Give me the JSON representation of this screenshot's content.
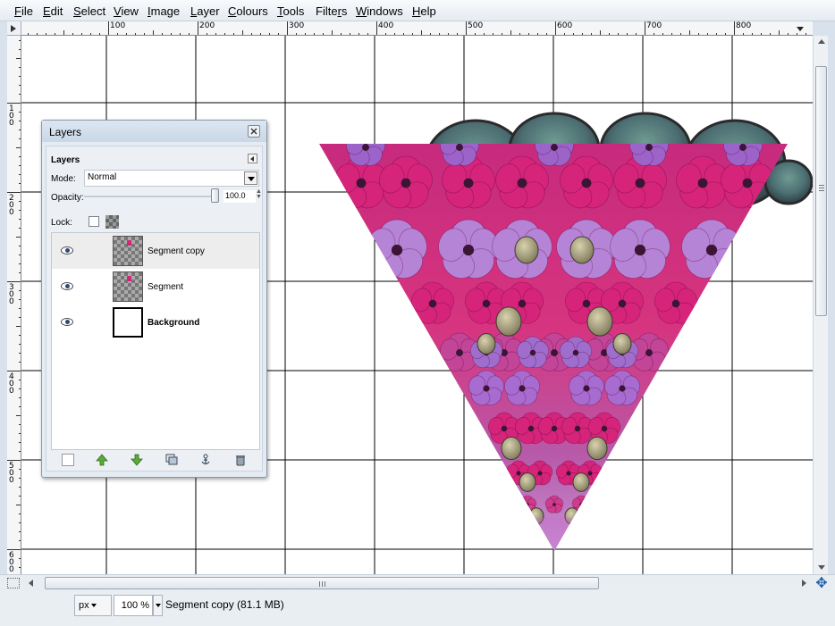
{
  "menu": [
    {
      "label": "File",
      "u": "F",
      "rest": "ile"
    },
    {
      "label": "Edit",
      "u": "E",
      "rest": "dit"
    },
    {
      "label": "Select",
      "u": "S",
      "rest": "elect"
    },
    {
      "label": "View",
      "u": "V",
      "rest": "iew"
    },
    {
      "label": "Image",
      "u": "I",
      "rest": "mage"
    },
    {
      "label": "Layer",
      "u": "L",
      "rest": "ayer"
    },
    {
      "label": "Colours",
      "u": "C",
      "rest": "olours"
    },
    {
      "label": "Tools",
      "u": "T",
      "rest": "ools"
    },
    {
      "label": "Filters",
      "pre": "Filte",
      "u": "r",
      "rest": "s"
    },
    {
      "label": "Windows",
      "u": "W",
      "rest": "indows"
    },
    {
      "label": "Help",
      "u": "H",
      "rest": "elp"
    }
  ],
  "rulers": {
    "horizontal_labels": [
      "100",
      "200",
      "300",
      "400",
      "500",
      "600",
      "700",
      "800"
    ],
    "vertical_labels": [
      "100",
      "200",
      "300",
      "400",
      "500",
      "600"
    ]
  },
  "layers_dialog": {
    "title": "Layers",
    "panel_label": "Layers",
    "mode_label": "Mode:",
    "mode_value": "Normal",
    "opacity_label": "Opacity:",
    "opacity_value": "100.0",
    "opacity": 1.0,
    "lock_label": "Lock:",
    "layers": [
      {
        "name": "Segment copy",
        "selected": true,
        "visible": true
      },
      {
        "name": "Segment",
        "selected": false,
        "visible": true
      },
      {
        "name": "Background",
        "selected": false,
        "visible": true
      }
    ],
    "buttons": [
      "new-layer",
      "raise-layer",
      "lower-layer",
      "duplicate-layer",
      "anchor-layer",
      "delete-layer"
    ]
  },
  "statusbar": {
    "unit": "px",
    "zoom": "100 %",
    "message": "Segment copy (81.1 MB)"
  },
  "colors": {
    "canvas_bg": "#ffffff",
    "grid": "#000000",
    "pink": "#d6247a",
    "lavender": "#b684d6",
    "accent_blue": "#1f5fa8"
  }
}
